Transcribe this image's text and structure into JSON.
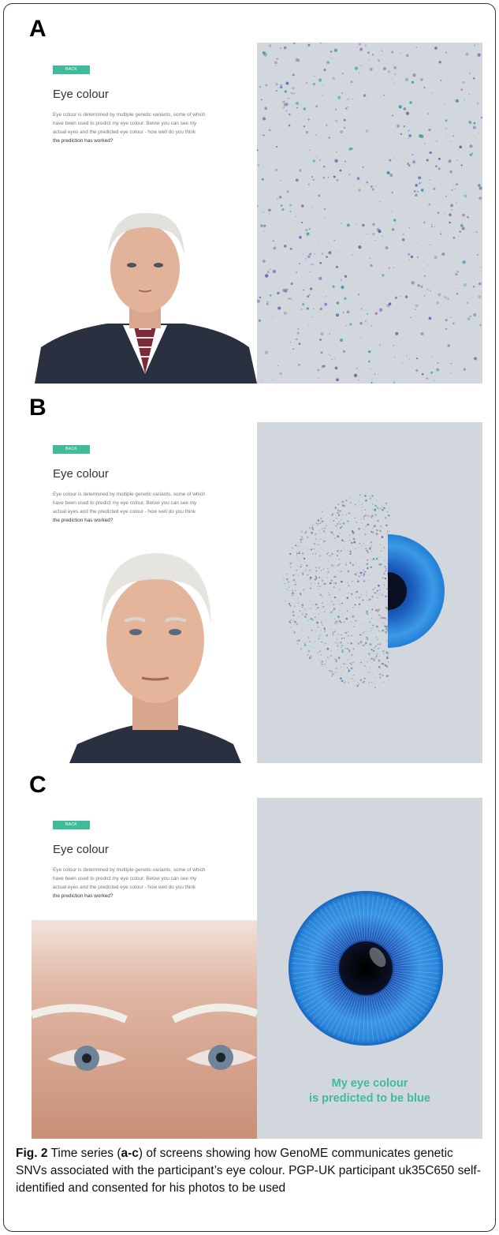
{
  "panels": [
    {
      "letter": "A"
    },
    {
      "letter": "B"
    },
    {
      "letter": "C"
    }
  ],
  "screen": {
    "back_label": "BACK",
    "title": "Eye colour",
    "description_line1": "Eye colour is determined by multiple genetic variants, some of which",
    "description_line2": "have been used to predict my eye colour. Below you can see my",
    "description_line3": "actual eyes and the predicted eye colour - how well do you think",
    "description_line4": "the prediction has worked?"
  },
  "prediction": {
    "line1": "My eye colour",
    "line2": "is predicted to be blue"
  },
  "caption": {
    "fig_label": "Fig. 2",
    "text_before": " Time series (",
    "panel_range": "a-c",
    "text_after": ") of screens showing how GenoME communicates genetic SNVs associated with the participant’s eye colour. PGP-UK participant uk35C650 self-identified and consented for his photos to be used"
  },
  "colors": {
    "accent": "#3dbb9a",
    "panel_bg": "#d2d7de",
    "eye_blue": "#1f7fd6"
  }
}
